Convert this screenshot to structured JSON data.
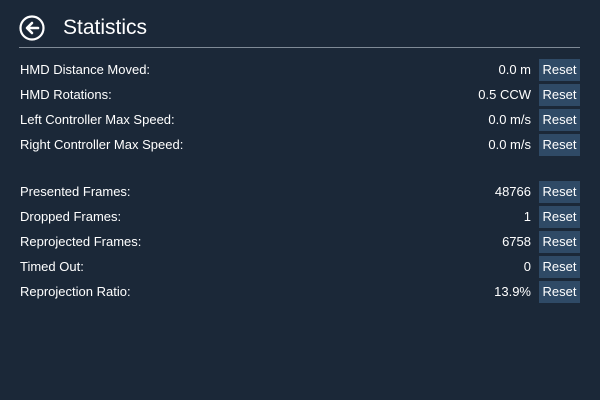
{
  "header": {
    "title": "Statistics",
    "back_icon": "back-arrow-circle-icon"
  },
  "colors": {
    "background": "#1b2838",
    "button": "#2f4a66",
    "divider": "#7f8a96",
    "text": "#ffffff"
  },
  "tracking_stats": [
    {
      "label": "HMD Distance Moved:",
      "value": "0.0 m",
      "button": "Reset"
    },
    {
      "label": "HMD Rotations:",
      "value": "0.5 CCW",
      "button": "Reset"
    },
    {
      "label": "Left Controller Max Speed:",
      "value": "0.0 m/s",
      "button": "Reset"
    },
    {
      "label": "Right Controller Max Speed:",
      "value": "0.0 m/s",
      "button": "Reset"
    }
  ],
  "frame_stats": [
    {
      "label": "Presented Frames:",
      "value": "48766",
      "button": "Reset"
    },
    {
      "label": "Dropped Frames:",
      "value": "1",
      "button": "Reset"
    },
    {
      "label": "Reprojected Frames:",
      "value": "6758",
      "button": "Reset"
    },
    {
      "label": "Timed Out:",
      "value": "0",
      "button": "Reset"
    },
    {
      "label": "Reprojection Ratio:",
      "value": "13.9%",
      "button": "Reset"
    }
  ]
}
